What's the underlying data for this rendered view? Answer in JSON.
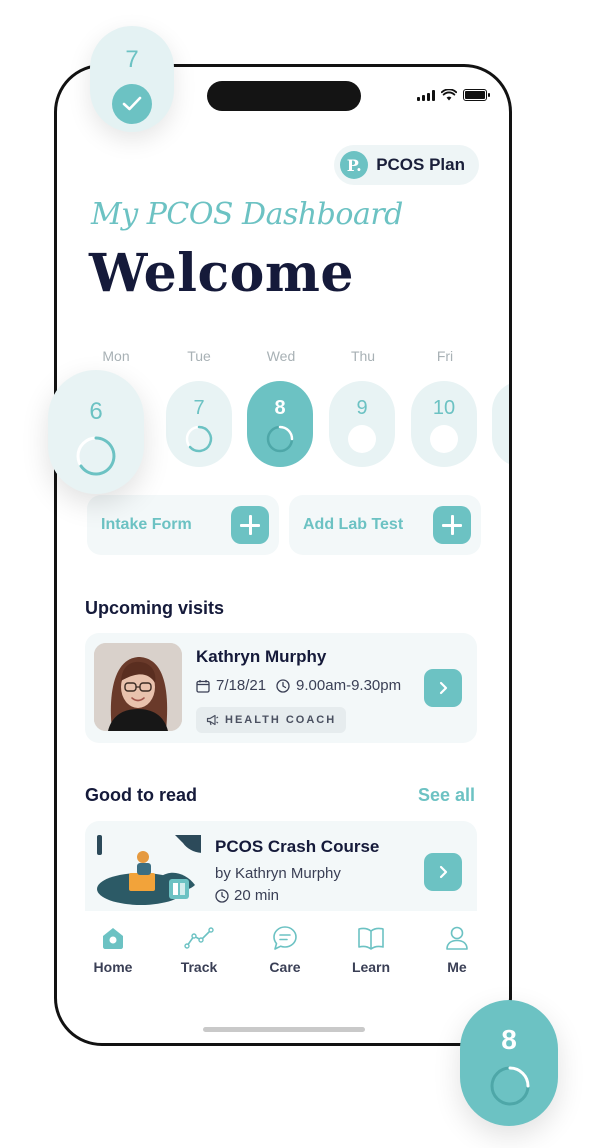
{
  "header": {
    "plan_logo_letter": "P.",
    "plan_label": "PCOS Plan",
    "script_title": "My PCOS Dashboard",
    "welcome": "Welcome"
  },
  "calendar": {
    "days": [
      {
        "label": "Mon",
        "date": "6",
        "state": "partial"
      },
      {
        "label": "Tue",
        "date": "7",
        "state": "partial"
      },
      {
        "label": "Wed",
        "date": "8",
        "state": "selected"
      },
      {
        "label": "Thu",
        "date": "9",
        "state": "empty"
      },
      {
        "label": "Fri",
        "date": "10",
        "state": "empty"
      }
    ]
  },
  "actions": {
    "intake_form": "Intake Form",
    "add_lab_test": "Add Lab Test"
  },
  "visits": {
    "title": "Upcoming visits",
    "items": [
      {
        "name": "Kathryn Murphy",
        "date": "7/18/21",
        "time": "9.00am-9.30pm",
        "role": "HEALTH COACH"
      }
    ]
  },
  "reading": {
    "title": "Good to read",
    "see_all": "See all",
    "items": [
      {
        "title": "PCOS Crash Course",
        "author": "by Kathryn Murphy",
        "duration": "20 min"
      }
    ]
  },
  "tabbar": {
    "items": [
      {
        "label": "Home",
        "icon": "home-icon",
        "active": true
      },
      {
        "label": "Track",
        "icon": "chart-line-icon",
        "active": false
      },
      {
        "label": "Care",
        "icon": "chat-icon",
        "active": false
      },
      {
        "label": "Learn",
        "icon": "book-icon",
        "active": false
      },
      {
        "label": "Me",
        "icon": "user-icon",
        "active": false
      }
    ]
  },
  "floating": {
    "top_day": "7",
    "left_day": "6",
    "bottom_day": "8"
  },
  "colors": {
    "accent": "#6cc2c3",
    "accent_light": "#e8f3f4",
    "navy": "#151a3a"
  }
}
